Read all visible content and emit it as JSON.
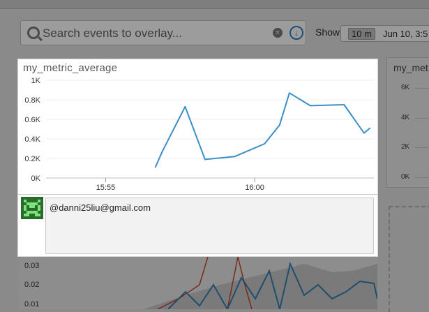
{
  "background": {
    "search": {
      "placeholder": "Search events to overlay...",
      "search_icon": "search-icon",
      "clear_icon": "clear-icon",
      "download_icon": "download-icon"
    },
    "show_label": "Show",
    "time_window": "10 m",
    "date_range": "Jun 10, 3:5",
    "second_card": {
      "title": "my_met",
      "y_ticks": [
        "6K",
        "4K",
        "2K",
        "0K"
      ]
    },
    "lower_chart_y_ticks": [
      "0.03",
      "0.02",
      "0.01"
    ]
  },
  "modal": {
    "chart_data": {
      "type": "line",
      "title": "my_metric_average",
      "xlabel": "",
      "ylabel": "",
      "x_ticks": [
        "15:55",
        "16:00"
      ],
      "y_ticks": [
        "1K",
        "0.8K",
        "0.6K",
        "0.4K",
        "0.2K",
        "0K"
      ],
      "ylim": [
        0,
        1000
      ],
      "grid": true,
      "series": [
        {
          "color": "#3a8fc7",
          "points": [
            {
              "x": "15:56:40",
              "y": 110
            },
            {
              "x": "15:56:54",
              "y": 270
            },
            {
              "x": "15:57:40",
              "y": 730
            },
            {
              "x": "15:58:20",
              "y": 190
            },
            {
              "x": "15:59:20",
              "y": 220
            },
            {
              "x": "16:00:20",
              "y": 350
            },
            {
              "x": "16:00:50",
              "y": 540
            },
            {
              "x": "16:01:10",
              "y": 870
            },
            {
              "x": "16:01:52",
              "y": 740
            },
            {
              "x": "16:03:00",
              "y": 750
            },
            {
              "x": "16:03:40",
              "y": 460
            },
            {
              "x": "16:03:52",
              "y": 510
            }
          ]
        }
      ]
    },
    "comment": {
      "author": "@danni25liu@gmail.com",
      "avatar_icon": "pixel-avatar-icon"
    }
  }
}
